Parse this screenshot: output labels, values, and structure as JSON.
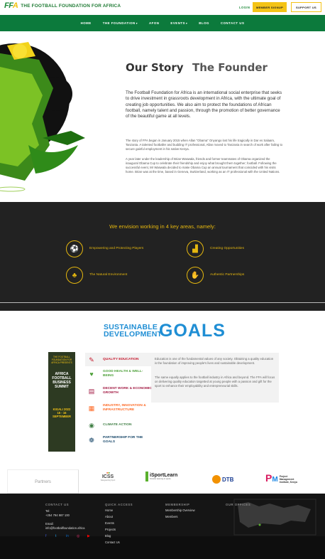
{
  "header": {
    "logo_mark": "FFA",
    "logo_name": "THE FOOTBALL FOUNDATION FOR AFRICA",
    "login": "LOGIN",
    "member_signup": "MEMBER SIGNUP",
    "support_us": "SUPPORT US"
  },
  "nav": {
    "items": [
      {
        "label": "HOME"
      },
      {
        "label": "THE FOUNDATION",
        "dropdown": true
      },
      {
        "label": "AFON"
      },
      {
        "label": "EVENTS",
        "dropdown": true
      },
      {
        "label": "BLOG"
      },
      {
        "label": "CONTACT US"
      }
    ]
  },
  "story": {
    "tab_story": "Our Story",
    "tab_founder": "The Founder",
    "lead": "The Football Foundation for Africa is an international social enterprise that seeks to drive investment in grassroots development in Africa, with the ultimate goal of creating job opportunities. We also aim to protect the foundations of African football, namely talent and passion, through the promotion of better governance of the beautiful game at all levels.",
    "para1": "The story of FFA began in January 2015 when Allan \"Obama\" Onyango lost his life tragically in Dar es Salaam, Tanzania. A talented footballer and budding IT professional, Allan moved to Tanzania in search of work after failing to secure gainful employment in his native Kenya.",
    "para2": "A year later under the leadership of Brian Waswala, friends and former teammates of Obama organized the inaugural Obama Cup to celebrate their friendship and enjoy what brought them together; football. Following the successful event, Mr Waswala decided to make Obama Cup an annual tournament that coincided with his visits home. Brian was at the time, based in Geneva, Switzerland, working as an IT professional with the United Nations."
  },
  "areas": {
    "heading": "We envision working in 4 key areas, namely:",
    "items": [
      {
        "label": "Empowering and Protecting Players",
        "icon": "shield-player-icon"
      },
      {
        "label": "Creating Opportunities",
        "icon": "chart-growth-icon"
      },
      {
        "label": "The Natural Environment",
        "icon": "plant-icon"
      },
      {
        "label": "Authentic Partnerships",
        "icon": "handshake-icon"
      }
    ]
  },
  "sdg": {
    "title_line1": "SUSTAINABLE",
    "title_line2": "DEVELOPMENT",
    "title_goals": "GOALS",
    "poster_top": "THE FOOTBALL FOUNDATION FOR AFRICA PRESENTS",
    "poster_title": "AFRICA FOOTBALL BUSINESS SUMMIT",
    "poster_date": "KIGALI 2022 15 - 16 SEPTEMBER",
    "goals": [
      {
        "label": "QUALITY EDUCATION",
        "color": "#c5192d",
        "icon": "book-icon"
      },
      {
        "label": "GOOD HEALTH & WELL-BEING",
        "color": "#4c9f38",
        "icon": "heartbeat-icon"
      },
      {
        "label": "DECENT WORK & ECONOMIC GROWTH",
        "color": "#a21942",
        "icon": "growth-icon"
      },
      {
        "label": "INDUSTRY, INNOVATION & INFRASTRUCTURE",
        "color": "#fd6925",
        "icon": "cubes-icon"
      },
      {
        "label": "CLIMATE ACTION",
        "color": "#3f7e44",
        "icon": "eye-globe-icon"
      },
      {
        "label": "PARTNERSHIP FOR THE GOALS",
        "color": "#19486a",
        "icon": "rings-icon"
      }
    ],
    "desc1": "Education is one of the fundamental values of any society. Obtaining a quality education is the foundation of improving people's lives and sustainable development.",
    "desc2": "The same equally applies to the football industry in Africa and beyond. The FFA will focus on delivering quality education targetted at young people with a passion and gift for the sport to enhance their employability and entrepreneurial skills."
  },
  "partners": {
    "label": "Partners",
    "logos": [
      "ICSS",
      "iSportLearn",
      "DTB",
      "Project Management Institute, Kenya"
    ],
    "isport_tagline": "Smarter learning in sports",
    "icss_tagline": "Safeguarding Sport"
  },
  "footer": {
    "contact_head": "CONTACT US",
    "tel_label": "Tel:",
    "tel": "+254 794 987 100",
    "email_label": "Email:",
    "email": "info@footballfoundation.africa",
    "quick_head": "QUICK ACCESS",
    "quick_links": [
      "Home",
      "About",
      "Events",
      "Projects",
      "Blog",
      "Contact Us"
    ],
    "membership_head": "MEMBERSHIP",
    "membership_links": [
      "Membership Overview",
      "Members"
    ],
    "offices_head": "OUR OFFICES"
  }
}
